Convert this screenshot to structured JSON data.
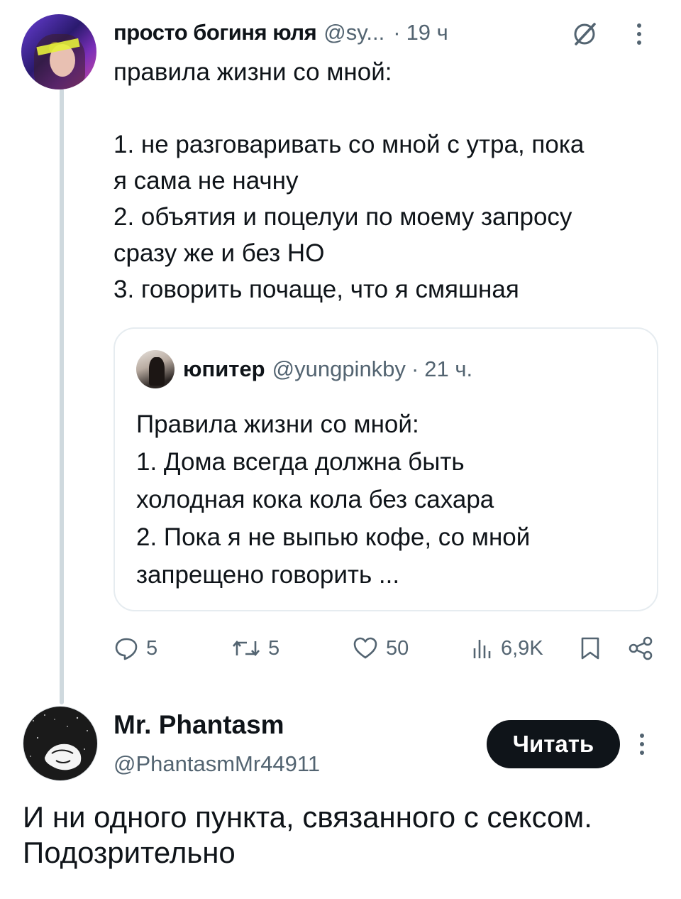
{
  "main_tweet": {
    "author_name": "просто богиня юля",
    "author_handle": "@sy...",
    "separator": "·",
    "time": "19 ч",
    "text_lines": [
      "правила жизни со мной:",
      "",
      "1. не разговаривать со мной с утра, пока",
      "я сама не начну",
      "2. объятия и поцелуи по моему запросу",
      "сразу же и без НО",
      "3. говорить почаще, что я смяшная"
    ],
    "quoted": {
      "author_name": "юпитер",
      "author_handle": "@yungpinkby",
      "separator": "·",
      "time": "21 ч.",
      "text_lines": [
        "Правила жизни со мной:",
        "1. Дома всегда должна быть",
        "холодная кока кола без сахара",
        "2. Пока я не выпью кофе, со мной",
        "запрещено говорить ..."
      ]
    },
    "actions": {
      "replies": "5",
      "reposts": "5",
      "likes": "50",
      "views": "6,9K"
    },
    "icons": [
      "grok-icon",
      "more-icon",
      "reply-icon",
      "repost-icon",
      "like-icon",
      "views-icon",
      "bookmark-icon",
      "share-icon"
    ]
  },
  "reply": {
    "author_name": "Mr. Phantasm",
    "author_handle": "@PhantasmMr44911",
    "follow_label": "Читать",
    "text_lines": [
      "И ни одного пункта, связанного с сексом.",
      "Подозрительно"
    ]
  },
  "colors": {
    "text": "#0f1419",
    "secondary": "#536471",
    "thread_line": "#cfd9de",
    "border": "#e6ecf0",
    "button_bg": "#0f1419"
  }
}
